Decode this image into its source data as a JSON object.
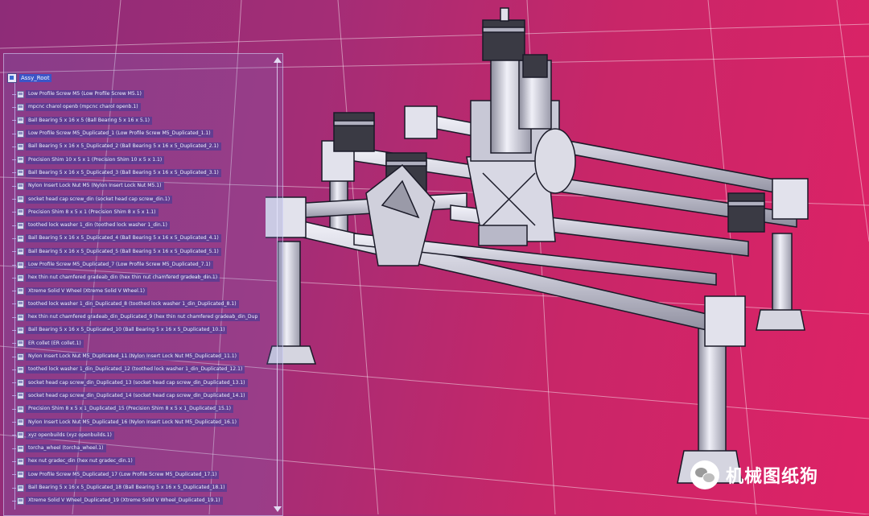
{
  "tree": {
    "root_label": "Assy_Root",
    "items": [
      {
        "label": "Low Profile Screw M5 (Low Profile Screw M5.1)"
      },
      {
        "label": "mpcnc charol openb (mpcnc charol openb.1)"
      },
      {
        "label": "Ball Bearing 5 x 16 x 5 (Ball Bearing 5 x 16 x 5.1)"
      },
      {
        "label": "Low Profile Screw M5_Duplicated_1 (Low Profile Screw M5_Duplicated_1.1)"
      },
      {
        "label": "Ball Bearing 5 x 16 x 5_Duplicated_2 (Ball Bearing 5 x 16 x 5_Duplicated_2.1)"
      },
      {
        "label": "Precision Shim 10 x 5 x 1 (Precision Shim 10 x 5 x 1.1)"
      },
      {
        "label": "Ball Bearing 5 x 16 x 5_Duplicated_3 (Ball Bearing 5 x 16 x 5_Duplicated_3.1)"
      },
      {
        "label": "Nylon Insert Lock Nut M5 (Nylon Insert Lock Nut M5.1)"
      },
      {
        "label": "socket head cap screw_din (socket head cap screw_din.1)"
      },
      {
        "label": "Precision Shim 8 x 5 x 1 (Precision Shim 8 x 5 x 1.1)"
      },
      {
        "label": "toothed lock washer 1_din (toothed lock washer 1_din.1)"
      },
      {
        "label": "Ball Bearing 5 x 16 x 5_Duplicated_4 (Ball Bearing 5 x 16 x 5_Duplicated_4.1)"
      },
      {
        "label": "Ball Bearing 5 x 16 x 5_Duplicated_5 (Ball Bearing 5 x 16 x 5_Duplicated_5.1)"
      },
      {
        "label": "Low Profile Screw M5_Duplicated_7 (Low Profile Screw M5_Duplicated_7.1)"
      },
      {
        "label": "hex thin nut chamfered gradeab_din (hex thin nut chamfered gradeab_din.1)"
      },
      {
        "label": "Xtreme Solid V Wheel (Xtreme Solid V Wheel.1)"
      },
      {
        "label": "toothed lock washer 1_din_Duplicated_8 (toothed lock washer 1_din_Duplicated_8.1)"
      },
      {
        "label": "hex thin nut chamfered gradeab_din_Duplicated_9 (hex thin nut chamfered gradeab_din_Dup"
      },
      {
        "label": "Ball Bearing 5 x 16 x 5_Duplicated_10 (Ball Bearing 5 x 16 x 5_Duplicated_10.1)"
      },
      {
        "label": "ER collet (ER collet.1)"
      },
      {
        "label": "Nylon Insert Lock Nut M5_Duplicated_11 (Nylon Insert Lock Nut M5_Duplicated_11.1)"
      },
      {
        "label": "toothed lock washer 1_din_Duplicated_12 (toothed lock washer 1_din_Duplicated_12.1)"
      },
      {
        "label": "socket head cap screw_din_Duplicated_13 (socket head cap screw_din_Duplicated_13.1)"
      },
      {
        "label": "socket head cap screw_din_Duplicated_14 (socket head cap screw_din_Duplicated_14.1)"
      },
      {
        "label": "Precision Shim 8 x 5 x 1_Duplicated_15 (Precision Shim 8 x 5 x 1_Duplicated_15.1)"
      },
      {
        "label": "Nylon Insert Lock Nut M5_Duplicated_16 (Nylon Insert Lock Nut M5_Duplicated_16.1)"
      },
      {
        "label": "xyz openbuilds (xyz openbuilds.1)"
      },
      {
        "label": "torcha_wheel (torcha_wheel.1)"
      },
      {
        "label": "hex nut gradec_din (hex nut gradec_din.1)"
      },
      {
        "label": "Low Profile Screw M5_Duplicated_17 (Low Profile Screw M5_Duplicated_17.1)"
      },
      {
        "label": "Ball Bearing 5 x 16 x 5_Duplicated_18 (Ball Bearing 5 x 16 x 5_Duplicated_18.1)"
      },
      {
        "label": "Xtreme Solid V Wheel_Duplicated_19 (Xtreme Solid V Wheel_Duplicated_19.1)"
      }
    ]
  },
  "watermark": {
    "text": "机械图纸狗",
    "icon": "wechat-icon"
  },
  "colors": {
    "background_left": "#8e2c78",
    "background_right": "#de2266",
    "grid_lines": "#ffffff",
    "selection": "#3b55c7"
  }
}
